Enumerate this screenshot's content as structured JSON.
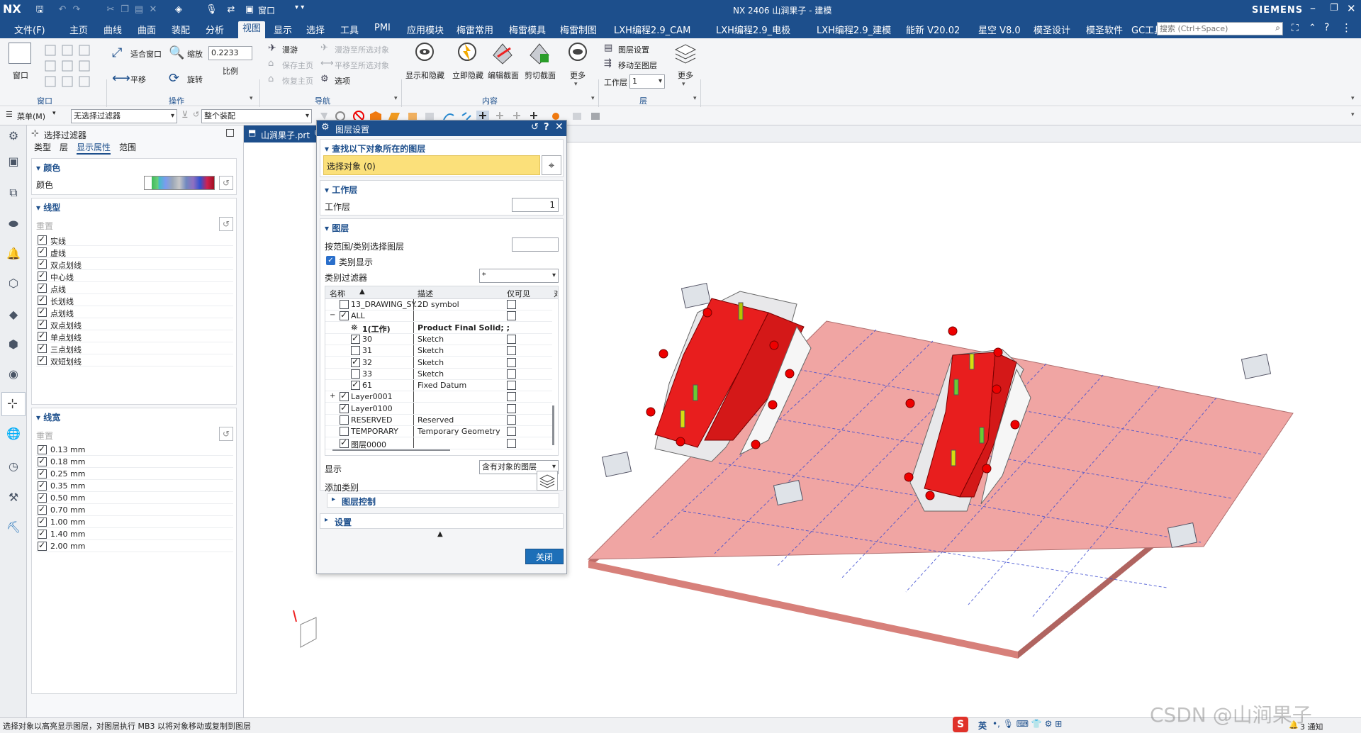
{
  "app": {
    "logo": "NX",
    "title": "NX 2406 山涧果子 - 建模",
    "brand": "SIEMENS",
    "window_menu": "窗口",
    "colors": {
      "accent": "#1d4f8c",
      "highlight": "#fbe07a",
      "part_red": "#e81e1e",
      "plate_pink": "#f0a0a0"
    }
  },
  "menubar": {
    "items": [
      "文件(F)",
      "主页",
      "曲线",
      "曲面",
      "装配",
      "分析",
      "视图",
      "显示",
      "选择",
      "工具",
      "PMI",
      "应用模块",
      "梅雷常用",
      "梅雷模具",
      "梅雷制图",
      "LXH编程2.9_CAM",
      "LXH编程2.9_电极",
      "LXH编程2.9_建模",
      "能新 V20.02",
      "星空 V8.0",
      "模圣设计",
      "模圣软件",
      "GC工具箱"
    ],
    "active": "视图",
    "search_placeholder": "搜索 (Ctrl+Space)"
  },
  "ribbon": {
    "window_label": "窗口",
    "fit_label": "适合窗口",
    "zoom_label": "缩放",
    "zoom_value": "0.2233",
    "scale_label": "比例",
    "pan_label": "平移",
    "rotate_label": "旋转",
    "group_operation": "操作",
    "roam_label": "漫游",
    "save_home_label": "保存主页",
    "restore_home_label": "恢复主页",
    "roam_to_new_label": "漫游至所选对象",
    "pan_to_new_label": "平移至所选对象",
    "options_label": "选项",
    "group_nav": "导航",
    "show_hide_label": "显示和隐藏",
    "instant_hide_label": "立即隐藏",
    "edit_section_label": "编辑截面",
    "clip_section_label": "剪切截面",
    "more_label": "更多",
    "group_content": "内容",
    "layer_settings_label": "图层设置",
    "move_to_layer_label": "移动至图层",
    "work_layer_label": "工作层",
    "work_layer_value": "1",
    "more2_label": "更多",
    "group_layer": "层"
  },
  "toolbar2": {
    "menu_label": "菜单(M)",
    "filter_value": "无选择过滤器",
    "scope_value": "整个装配"
  },
  "navpanel": {
    "title": "选择过滤器",
    "tabs": [
      "类型",
      "层",
      "显示属性",
      "范围"
    ],
    "active_tab": "显示属性",
    "color_section": "颜色",
    "color_label": "颜色",
    "linetype_section": "线型",
    "linetype_reset": "重置",
    "linetypes": [
      "实线",
      "虚线",
      "双点划线",
      "中心线",
      "点线",
      "长划线",
      "点划线",
      "双点划线",
      "单点划线",
      "三点划线",
      "双短划线"
    ],
    "linewidth_section": "线宽",
    "linewidth_reset": "重置",
    "linewidths": [
      "0.13 mm",
      "0.18 mm",
      "0.25 mm",
      "0.35 mm",
      "0.50 mm",
      "0.70 mm",
      "1.00 mm",
      "1.40 mm",
      "2.00 mm"
    ]
  },
  "filetab": {
    "name": "山涧果子.prt"
  },
  "dialog": {
    "title": "图层设置",
    "find_section": "查找以下对象所在的图层",
    "select_object": "选择对象 (0)",
    "work_section": "工作层",
    "work_label": "工作层",
    "work_value": "1",
    "layer_section": "图层",
    "range_label": "按范围/类别选择图层",
    "category_display": "类别显示",
    "category_filter_label": "类别过滤器",
    "category_filter_value": "*",
    "columns": [
      "名称",
      "描述",
      "仅可见",
      "对"
    ],
    "rows": [
      {
        "name": "13_DRAWING_SY...",
        "desc": "2D symbol",
        "checked": false,
        "indent": 1
      },
      {
        "name": "ALL",
        "desc": "",
        "checked": true,
        "indent": 1,
        "expander": "−"
      },
      {
        "name": "1(工作)",
        "desc": "Product Final Solid; ;",
        "checked": null,
        "indent": 2,
        "bold": true
      },
      {
        "name": "30",
        "desc": "Sketch",
        "checked": true,
        "indent": 2
      },
      {
        "name": "31",
        "desc": "Sketch",
        "checked": false,
        "indent": 2
      },
      {
        "name": "32",
        "desc": "Sketch",
        "checked": true,
        "indent": 2
      },
      {
        "name": "33",
        "desc": "Sketch",
        "checked": false,
        "indent": 2
      },
      {
        "name": "61",
        "desc": "Fixed Datum",
        "checked": true,
        "indent": 2
      },
      {
        "name": "Layer0001",
        "desc": "",
        "checked": true,
        "indent": 1,
        "expander": "+"
      },
      {
        "name": "Layer0100",
        "desc": "",
        "checked": true,
        "indent": 1
      },
      {
        "name": "RESERVED",
        "desc": "Reserved",
        "checked": false,
        "indent": 1
      },
      {
        "name": "TEMPORARY",
        "desc": "Temporary Geometry",
        "checked": false,
        "indent": 1
      },
      {
        "name": "图层0000",
        "desc": "",
        "checked": true,
        "indent": 1
      }
    ],
    "show_label": "显示",
    "show_value": "含有对象的图层",
    "add_category": "添加类别",
    "layer_control": "图层控制",
    "settings_section": "设置",
    "close_button": "关闭"
  },
  "status": {
    "message": "选择对象以高亮显示图层，对图层执行 MB3 以将对象移动或复制到图层",
    "ime": "英",
    "notifications": "3 通知",
    "watermark": "CSDN @山涧果子"
  }
}
